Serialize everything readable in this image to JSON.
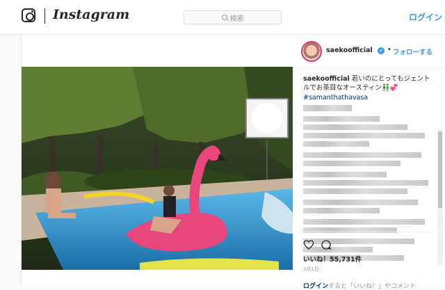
{
  "header": {
    "logo_text": "Instagram",
    "search_placeholder": "検索",
    "login_label": "ログイン"
  },
  "post": {
    "username": "saekoofficial",
    "verified_mark": "✔",
    "separator": "•",
    "follow_label": "フォローする",
    "caption_user": "saekoofficial",
    "caption_text": "若いのにとってもジェントルでお茶目なオースティン👬💞",
    "hashtag": "#samanthathavasa",
    "likes": "いいね！55,731件",
    "date": "2月1日",
    "login_prompt_link": "ログイン",
    "login_prompt_text": "すると「いいね！」やコメント"
  },
  "colors": {
    "accent": "#3897f0",
    "hashtag": "#003569",
    "pool": "#2f8fc8",
    "flamingo": "#e8467c"
  },
  "icons": [
    "camera-icon",
    "search-icon",
    "verified-icon",
    "heart-icon",
    "comment-icon"
  ]
}
